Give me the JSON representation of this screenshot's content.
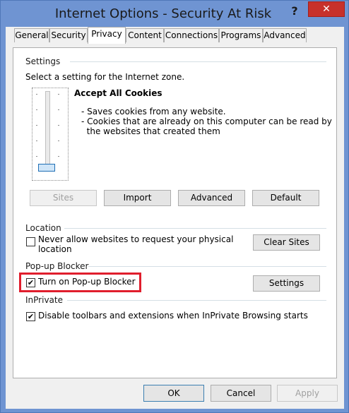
{
  "window": {
    "title": "Internet Options - Security At Risk",
    "help": "?",
    "close": "✕"
  },
  "tabs": [
    {
      "label": "General"
    },
    {
      "label": "Security"
    },
    {
      "label": "Privacy"
    },
    {
      "label": "Content"
    },
    {
      "label": "Connections"
    },
    {
      "label": "Programs"
    },
    {
      "label": "Advanced"
    }
  ],
  "settings": {
    "group": "Settings",
    "prompt": "Select a setting for the Internet zone.",
    "level_title": "Accept All Cookies",
    "desc1": "- Saves cookies from any website.",
    "desc2": "- Cookies that are already on this computer can be read by",
    "desc3": "  the websites that created them",
    "buttons": {
      "sites": "Sites",
      "import": "Import",
      "advanced": "Advanced",
      "default": "Default"
    }
  },
  "location": {
    "group": "Location",
    "check_line1": "Never allow websites to request your physical",
    "check_line2": "location",
    "clear": "Clear Sites"
  },
  "popup": {
    "group": "Pop-up Blocker",
    "check": "Turn on Pop-up Blocker",
    "settings": "Settings"
  },
  "inprivate": {
    "group": "InPrivate",
    "check": "Disable toolbars and extensions when InPrivate Browsing starts"
  },
  "footer": {
    "ok": "OK",
    "cancel": "Cancel",
    "apply": "Apply"
  }
}
